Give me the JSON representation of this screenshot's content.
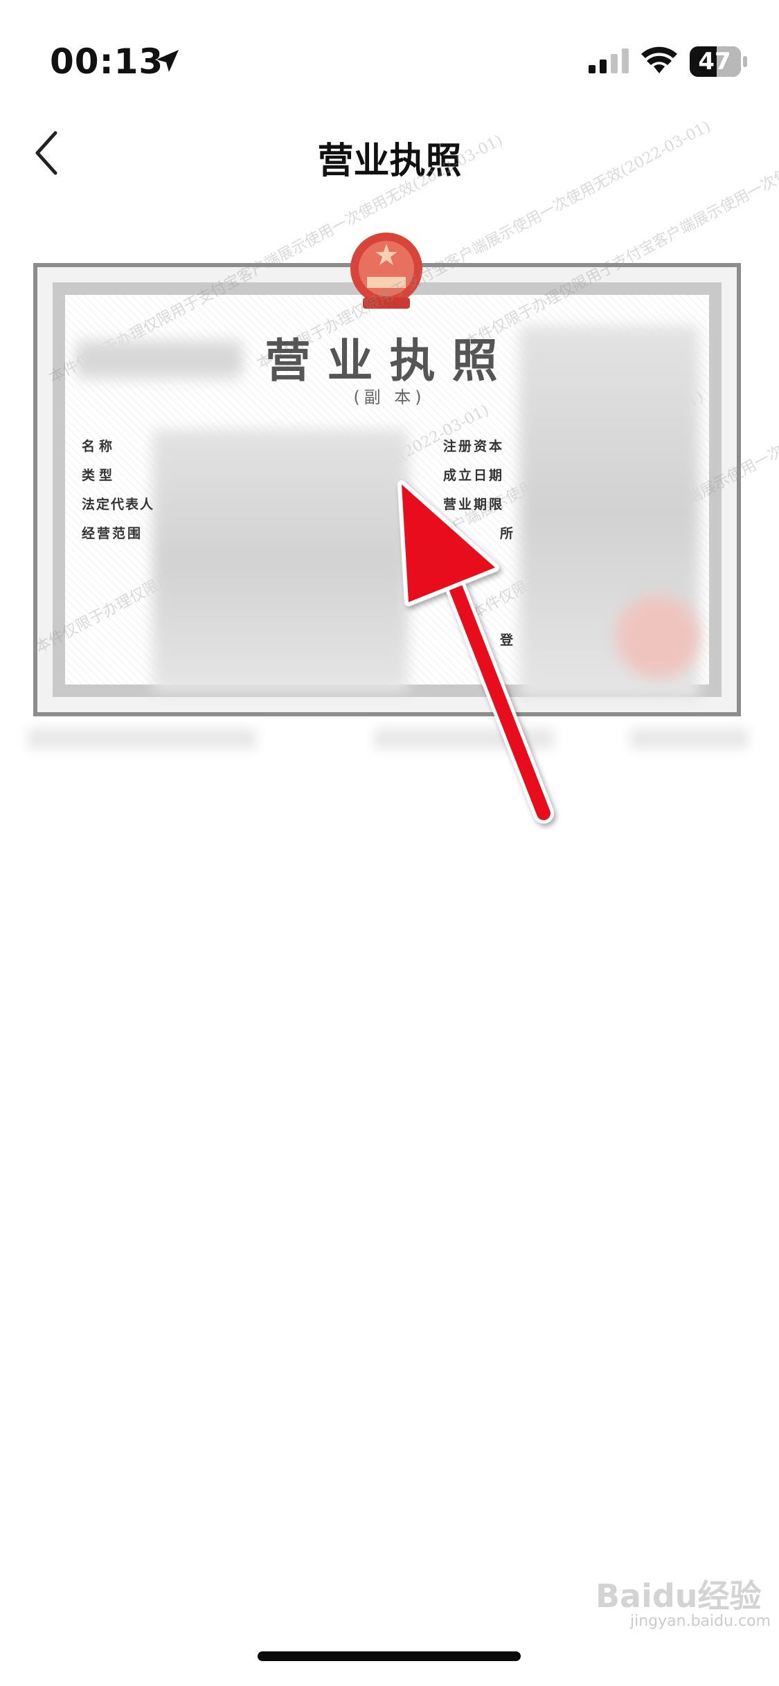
{
  "status_bar": {
    "time": "00:13",
    "battery": "47"
  },
  "nav": {
    "title": "营业执照"
  },
  "license": {
    "title": "营业执照",
    "subtitle": "(副 本)",
    "left_fields": [
      "名称",
      "类型",
      "法定代表人",
      "经营范围"
    ],
    "right_fields": [
      "注册资本",
      "成立日期",
      "营业期限",
      "所",
      "登"
    ],
    "watermark": "本件仅限于办理仅限用于支付宝客户端展示使用一次使用无效(2022-03-01)"
  },
  "footer_watermark": {
    "logo": "Baidu经验",
    "sub": "jingyan.baidu.com"
  },
  "colors": {
    "arrow": "#e8101a",
    "emblem": "#d9443a"
  }
}
